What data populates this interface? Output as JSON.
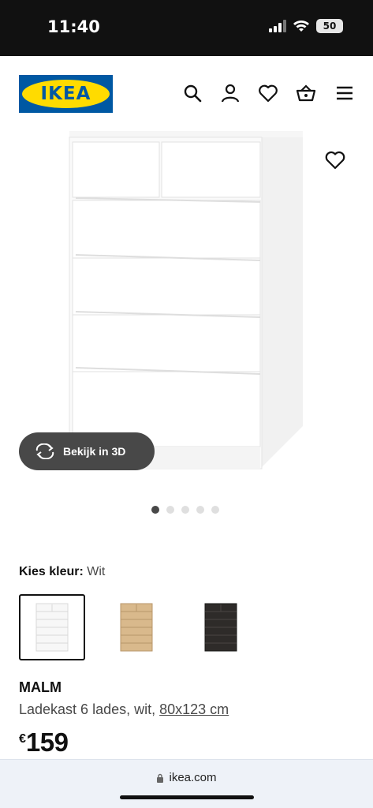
{
  "status": {
    "time": "11:40",
    "battery": "50"
  },
  "header": {
    "logo_text": "IKEA",
    "icons": [
      "search-icon",
      "user-icon",
      "heart-icon",
      "basket-icon",
      "menu-icon"
    ],
    "brand_blue": "#0058a3",
    "brand_yellow": "#ffdb00"
  },
  "gallery": {
    "view3d_label": "Bekijk in 3D",
    "dots_total": 5,
    "dots_active_index": 0
  },
  "product": {
    "color_label": "Kies kleur:",
    "color_value": "Wit",
    "swatches": [
      {
        "name": "Wit",
        "color": "#f4f4f4",
        "selected": true
      },
      {
        "name": "eiken",
        "color": "#d9b98c",
        "selected": false
      },
      {
        "name": "zwartbruin",
        "color": "#2e2b29",
        "selected": false
      }
    ],
    "name": "MALM",
    "description": "Ladekast 6 lades, wit,",
    "size": "80x123 cm",
    "price_currency": "€",
    "price_amount": "159"
  },
  "browser": {
    "url": "ikea.com"
  }
}
